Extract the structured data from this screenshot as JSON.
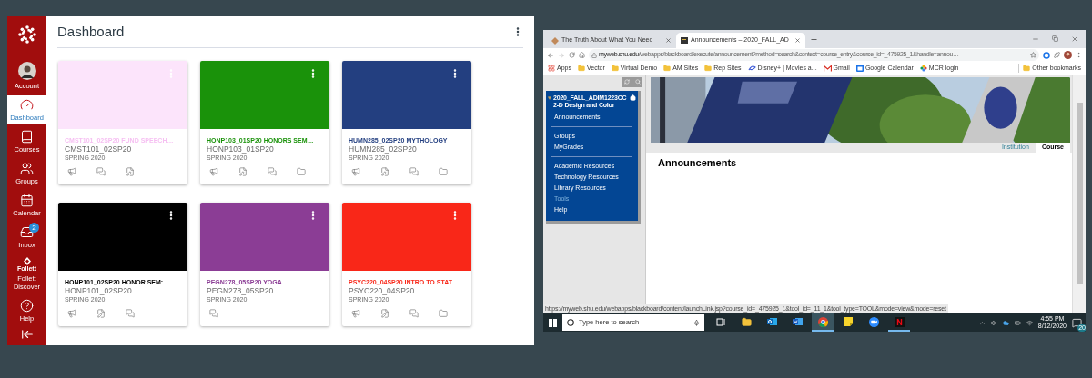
{
  "canvas": {
    "nav": [
      {
        "kind": "logo"
      },
      {
        "kind": "account",
        "label": "Account",
        "selected": false
      },
      {
        "kind": "dashboard",
        "label": "Dashboard",
        "selected": true
      },
      {
        "kind": "courses",
        "label": "Courses",
        "selected": false
      },
      {
        "kind": "groups",
        "label": "Groups",
        "selected": false
      },
      {
        "kind": "calendar",
        "label": "Calendar",
        "selected": false
      },
      {
        "kind": "inbox",
        "label": "Inbox",
        "selected": false,
        "badge": "2"
      },
      {
        "kind": "follett",
        "label": "Follett Discover",
        "logo_text": "Follett",
        "selected": false
      },
      {
        "kind": "help",
        "label": "Help",
        "selected": false
      },
      {
        "kind": "collapse"
      }
    ],
    "title": "Dashboard",
    "cards": [
      {
        "color": "#fce4fb",
        "title": {
          "text": "CMST101_02SP20 FUND SPEECH…",
          "color": "#f6bff2"
        },
        "code": "CMST101_02SP20",
        "term": "SPRING 2020",
        "actions": [
          {
            "kind": "announcements"
          },
          {
            "kind": "discussions"
          },
          {
            "kind": "assignments"
          }
        ]
      },
      {
        "color": "#1a920a",
        "title": {
          "text": "HONP103_01SP20 HONORS SEM…",
          "color": "#1a920a"
        },
        "code": "HONP103_01SP20",
        "term": "SPRING 2020",
        "actions": [
          {
            "kind": "announcements"
          },
          {
            "kind": "assignments"
          },
          {
            "kind": "discussions"
          },
          {
            "kind": "files"
          }
        ]
      },
      {
        "color": "#233f80",
        "title": {
          "text": "HUMN285_02SP20 MYTHOLOGY",
          "color": "#233f80"
        },
        "code": "HUMN285_02SP20",
        "term": "SPRING 2020",
        "actions": [
          {
            "kind": "announcements"
          },
          {
            "kind": "assignments"
          },
          {
            "kind": "discussions"
          },
          {
            "kind": "files"
          }
        ]
      },
      {
        "color": "#000000",
        "title": {
          "text": "HONP101_02SP20 HONOR SEM:…",
          "color": "#000000"
        },
        "code": "HONP101_02SP20",
        "term": "SPRING 2020",
        "actions": [
          {
            "kind": "announcements"
          },
          {
            "kind": "assignments"
          },
          {
            "kind": "discussions"
          }
        ]
      },
      {
        "color": "#8b3d95",
        "title": {
          "text": "PEGN278_05SP20 YOGA",
          "color": "#8b3d95"
        },
        "code": "PEGN278_05SP20",
        "term": "SPRING 2020",
        "actions": [
          {
            "kind": "discussions"
          }
        ]
      },
      {
        "color": "#f92718",
        "title": {
          "text": "PSYC220_04SP20 INTRO TO STAT…",
          "color": "#f92718"
        },
        "code": "PSYC220_04SP20",
        "term": "SPRING 2020",
        "actions": [
          {
            "kind": "announcements"
          },
          {
            "kind": "assignments"
          },
          {
            "kind": "discussions"
          },
          {
            "kind": "files"
          }
        ]
      }
    ]
  },
  "browser": {
    "tabs": [
      {
        "title": "The Truth About What You Need",
        "selected": false
      },
      {
        "title": "Announcements – 2020_FALL_AD",
        "selected": true
      }
    ],
    "url_host": "myweb.shu.edu",
    "url_path": "/webapps/blackboard/execute/announcement?method=search&context=course_entry&course_id=_475925_1&handle=annou…",
    "bookmarks": [
      {
        "kind": "apps",
        "label": "Apps"
      },
      {
        "kind": "folder",
        "label": "Vector"
      },
      {
        "kind": "folder",
        "label": "Virtual Demo"
      },
      {
        "kind": "folder",
        "label": "AM Sites"
      },
      {
        "kind": "folder",
        "label": "Rep Sites"
      },
      {
        "kind": "disney",
        "label": "Disney+ | Movies a..."
      },
      {
        "kind": "gmail",
        "label": "Gmail"
      },
      {
        "kind": "calendar",
        "label": "Google Calendar"
      },
      {
        "kind": "mcr",
        "label": "MCR login"
      }
    ],
    "other_bookmarks": "Other bookmarks",
    "course_menu": {
      "title": "2020_FALL_ADIM1223CC 2-D Design and Color",
      "groups": [
        [
          {
            "label": "Announcements",
            "disabled": false
          }
        ],
        [
          {
            "label": "Groups",
            "disabled": false
          },
          {
            "label": "MyGrades",
            "disabled": false
          }
        ],
        [
          {
            "label": "Academic Resources",
            "disabled": false
          },
          {
            "label": "Technology Resources",
            "disabled": false
          },
          {
            "label": "Library Resources",
            "disabled": false
          },
          {
            "label": "Tools",
            "disabled": true
          },
          {
            "label": "Help",
            "disabled": false
          }
        ]
      ]
    },
    "banner_tabs": [
      {
        "label": "Institution",
        "selected": false
      },
      {
        "label": "Course",
        "selected": true
      }
    ],
    "heading": "Announcements",
    "status_url": "https://myweb.shu.edu/webapps/blackboard/content/launchLink.jsp?course_id=_475925_1&tool_id=_11_1&tool_type=TOOL&mode=view&mode=reset"
  },
  "taskbar": {
    "search_placeholder": "Type here to search",
    "apps": [
      {
        "kind": "task_view",
        "selected": false,
        "running": false
      },
      {
        "kind": "explorer",
        "selected": false,
        "running": false
      },
      {
        "kind": "outlook",
        "selected": false,
        "running": false
      },
      {
        "kind": "word",
        "selected": false,
        "running": false
      },
      {
        "kind": "chrome",
        "selected": true,
        "running": true
      },
      {
        "kind": "sticky",
        "selected": false,
        "running": false
      },
      {
        "kind": "zoom",
        "selected": false,
        "running": false
      },
      {
        "kind": "netflix",
        "selected": false,
        "running": true
      }
    ],
    "time": "4:55 PM",
    "date": "8/12/2020",
    "notifications": "20"
  }
}
